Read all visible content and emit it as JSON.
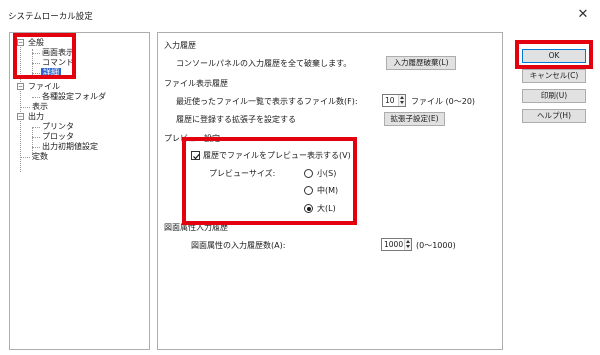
{
  "window": {
    "title": "システムローカル設定",
    "close_glyph": "✕"
  },
  "tree": {
    "items": [
      {
        "label": "全般"
      },
      {
        "label": "画面表示"
      },
      {
        "label": "コマンド"
      },
      {
        "label": "詳細",
        "selected": true
      },
      {
        "label": "ファイル"
      },
      {
        "label": "各種設定フォルダ"
      },
      {
        "label": "表示"
      },
      {
        "label": "出力"
      },
      {
        "label": "プリンタ"
      },
      {
        "label": "プロッタ"
      },
      {
        "label": "出力初期値設定"
      },
      {
        "label": "定数"
      }
    ],
    "expand_glyph": "−"
  },
  "input_history": {
    "heading": "入力履歴",
    "description": "コンソールパネルの入力履歴を全て破棄します。",
    "discard_button": "入力履歴破棄(L)"
  },
  "file_history": {
    "heading": "ファイル表示履歴",
    "recent_label": "最近使ったファイル一覧で表示するファイル数(F):",
    "recent_value": "10",
    "recent_unit": "ファイル (0〜20)",
    "ext_label": "履歴に登録する拡張子を設定する",
    "ext_button": "拡張子設定(E)"
  },
  "preview": {
    "heading": "プレビュー設定",
    "checkbox_label": "履歴でファイルをプレビュー表示する(V)",
    "checkbox_checked": true,
    "size_label": "プレビューサイズ:",
    "sizes": [
      {
        "label": "小(S)",
        "checked": false
      },
      {
        "label": "中(M)",
        "checked": false
      },
      {
        "label": "大(L)",
        "checked": true
      }
    ]
  },
  "attr_history": {
    "heading": "図面属性入力履歴",
    "count_label": "図面属性の入力履歴数(A):",
    "count_value": "1000",
    "count_range": "(0〜1000)"
  },
  "buttons": {
    "ok": "OK",
    "cancel": "キャンセル(C)",
    "print": "印刷(U)",
    "help": "ヘルプ(H)"
  },
  "colors": {
    "highlight": "#e3000f",
    "selection": "#2f64c8",
    "default_button_border": "#0078d7"
  }
}
